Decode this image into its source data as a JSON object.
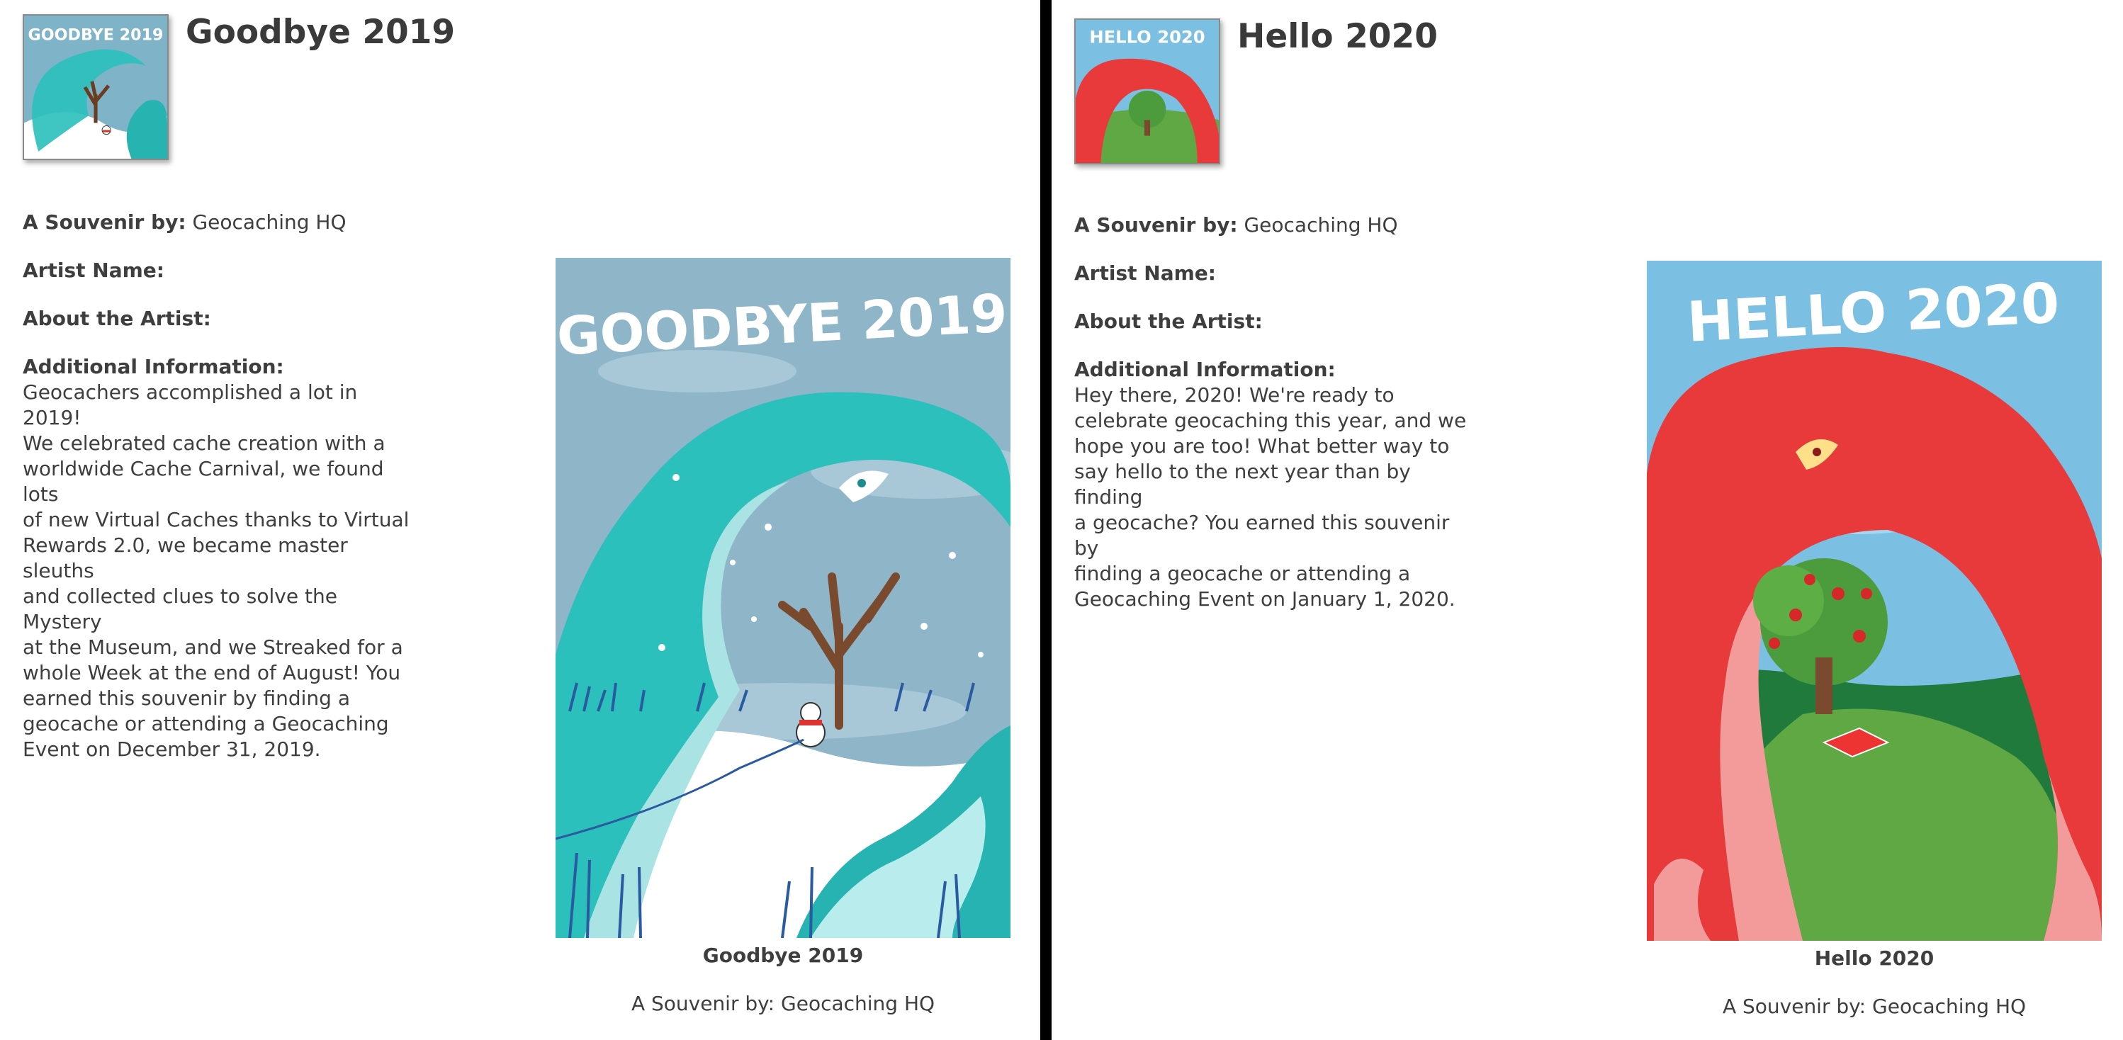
{
  "left": {
    "badge_text": "GOODBYE 2019",
    "title": "Goodbye 2019",
    "souvenir_label": "A Souvenir by:",
    "souvenir_value": "Geocaching HQ",
    "artist_label": "Artist Name:",
    "about_label": "About the Artist:",
    "additional_label": "Additional Information:",
    "additional_text": "Geocachers accomplished a lot in 2019!\nWe celebrated cache creation with a\nworldwide Cache Carnival, we found lots\nof new Virtual Caches thanks to Virtual\nRewards 2.0, we became master sleuths\nand collected clues to solve the Mystery\nat the Museum, and we Streaked for a\nwhole Week at the end of August! You\nearned this souvenir by finding a\ngeocache or attending a Geocaching\nEvent on December 31, 2019.",
    "poster_text": "GOODBYE 2019",
    "caption": "Goodbye 2019",
    "byline": "A Souvenir by: Geocaching HQ"
  },
  "right": {
    "badge_text": "HELLO 2020",
    "title": "Hello 2020",
    "souvenir_label": "A Souvenir by:",
    "souvenir_value": "Geocaching HQ",
    "artist_label": "Artist Name:",
    "about_label": "About the Artist:",
    "additional_label": "Additional Information:",
    "additional_text": "Hey there, 2020! We're ready to\ncelebrate geocaching this year, and we\nhope you are too! What better way to\nsay hello to the next year than by finding\na geocache? You earned this souvenir by\nfinding a geocache or attending a\nGeocaching Event on January 1, 2020.",
    "poster_text": "HELLO 2020",
    "caption": "Hello 2020",
    "byline": "A Souvenir by: Geocaching HQ"
  },
  "colors": {
    "winter_sky": "#8fb5c9",
    "winter_teal": "#26b8b8",
    "summer_sky": "#7bbfe3",
    "summer_red": "#e83a3a",
    "grass": "#5fa843",
    "divider": "#000000"
  }
}
